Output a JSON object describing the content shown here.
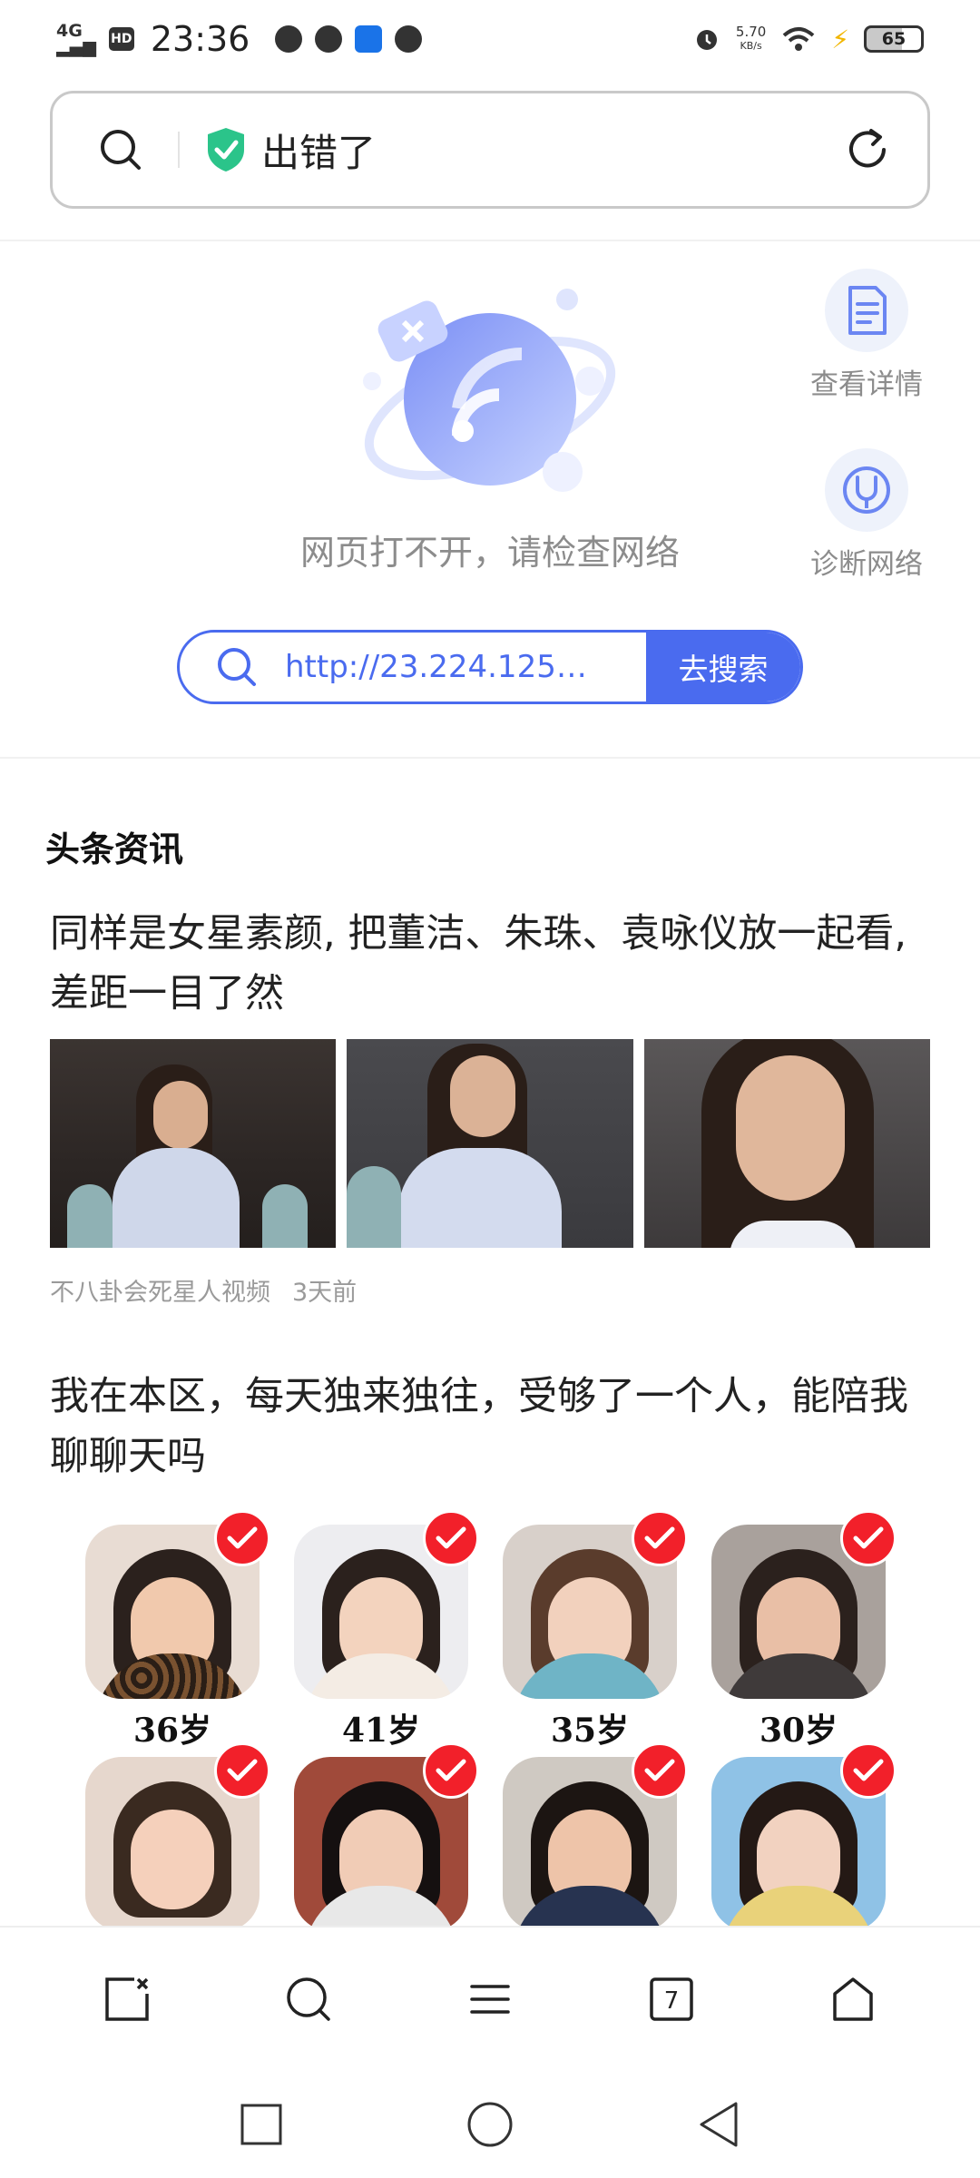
{
  "status_bar": {
    "network": "4G",
    "hd": "HD",
    "time": "23:36",
    "speed_value": "5.70",
    "speed_unit": "KB/s",
    "battery": "65"
  },
  "address_bar": {
    "title": "出错了"
  },
  "error": {
    "message": "网页打不开，请检查网络",
    "actions": [
      {
        "label": "查看详情"
      },
      {
        "label": "诊断网络"
      }
    ],
    "url_value": "http://23.224.125.…",
    "go_button": "去搜索"
  },
  "news": {
    "section_title": "头条资讯",
    "article1": {
      "title": "同样是女星素颜, 把董洁、朱珠、袁咏仪放一起看, 差距一目了然",
      "source": "不八卦会死星人视频",
      "time": "3天前"
    },
    "article2": {
      "title": "我在本区，每天独来独往，受够了一个人，能陪我聊聊天吗",
      "ages": [
        "36岁",
        "41岁",
        "35岁",
        "30岁"
      ]
    }
  },
  "toolbar": {
    "tab_count": "7"
  },
  "colors": {
    "accent": "#4a6bef",
    "check": "#f2202a",
    "shield": "#2bc48a"
  }
}
